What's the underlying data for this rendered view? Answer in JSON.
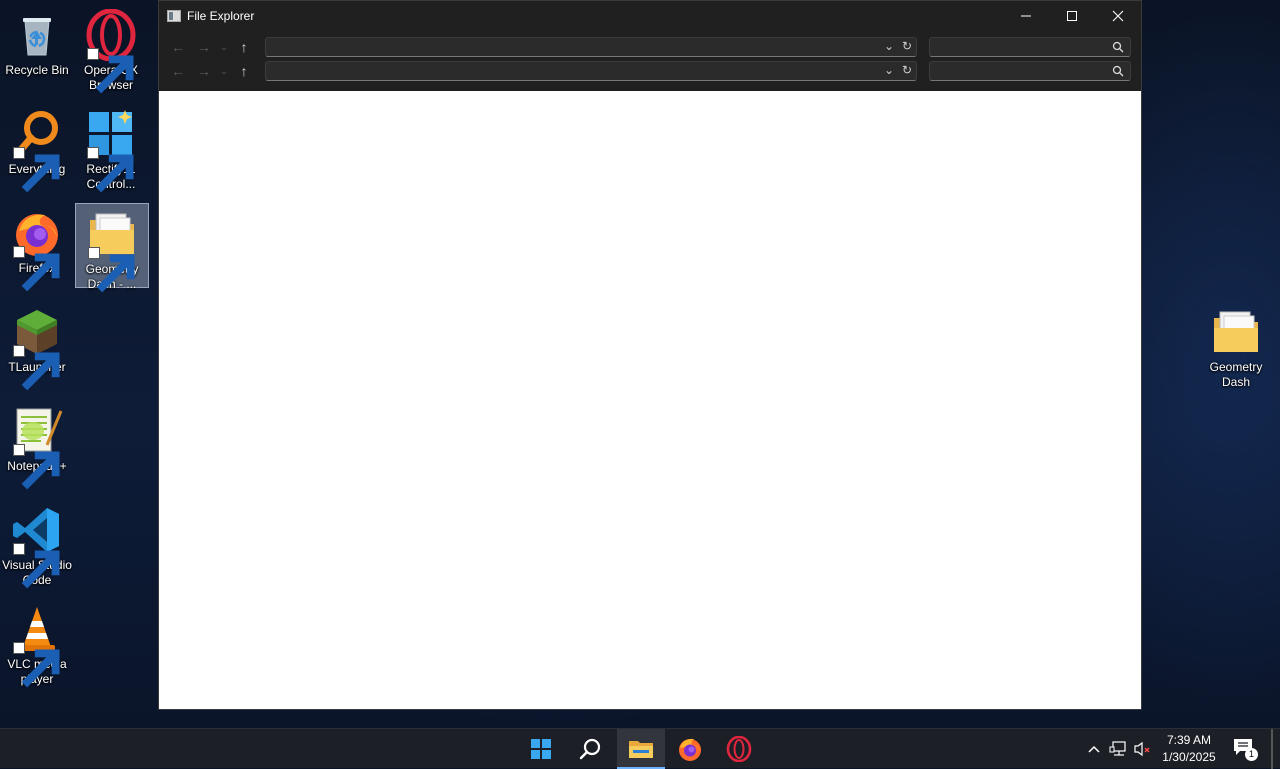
{
  "desktop": {
    "icons": [
      {
        "label": "Recycle Bin",
        "icon": "recycle-bin-icon"
      },
      {
        "label": "Opera GX Browser",
        "icon": "opera-gx-icon"
      },
      {
        "label": "Everything",
        "icon": "everything-search-icon"
      },
      {
        "label": "Rectify11 Control...",
        "icon": "rectify11-icon"
      },
      {
        "label": "Firefox",
        "icon": "firefox-icon"
      },
      {
        "label": "Geometry Dash - ...",
        "icon": "folder-shortcut-icon"
      },
      {
        "label": "TLauncher",
        "icon": "tlauncher-icon"
      },
      {
        "label": "Notepad++",
        "icon": "notepad-plus-plus-icon"
      },
      {
        "label": "Visual Studio Code",
        "icon": "vscode-icon"
      },
      {
        "label": "VLC media player",
        "icon": "vlc-icon"
      },
      {
        "label": "Geometry Dash",
        "icon": "folder-icon"
      }
    ]
  },
  "window": {
    "title": "File Explorer",
    "address_rows": [
      {
        "address_value": "",
        "search_value": ""
      },
      {
        "address_value": "",
        "search_value": ""
      }
    ]
  },
  "taskbar": {
    "apps": [
      "start-icon",
      "search-icon",
      "file-explorer-icon",
      "firefox-icon",
      "opera-gx-icon"
    ],
    "active_app": "file-explorer-icon",
    "time": "7:39 AM",
    "date": "1/30/2025",
    "notification_count": "1"
  },
  "colors": {
    "accent": "#6fb1ff",
    "window_bg": "#202020",
    "content_bg": "#ffffff"
  }
}
